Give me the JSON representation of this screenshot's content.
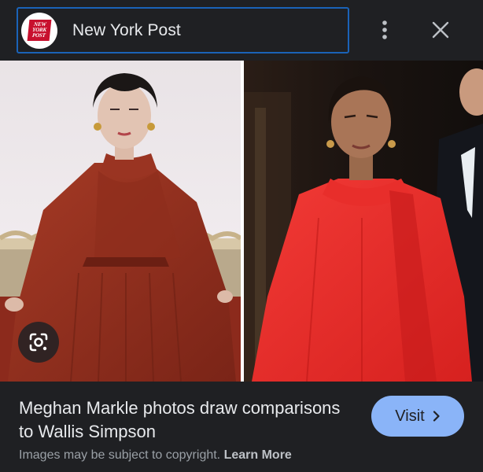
{
  "header": {
    "source_name": "New York Post",
    "logo_lines": [
      "NEW",
      "YORK",
      "POST"
    ],
    "logo_color": "#c8102e",
    "more_icon": "more-vert-icon",
    "close_icon": "close-icon"
  },
  "image": {
    "description_left": "portrait photo",
    "description_right": "portrait photo",
    "lens_icon": "google-lens-icon"
  },
  "caption": {
    "title": "Meghan Markle photos draw comparisons to Wallis Simpson",
    "visit_label": "Visit",
    "visit_icon": "chevron-right-icon",
    "copyright_text": "Images may be subject to copyright.",
    "learn_more": "Learn More"
  },
  "colors": {
    "background": "#1f2023",
    "accent": "#8ab4f8",
    "focus_border": "#1a63b8"
  }
}
